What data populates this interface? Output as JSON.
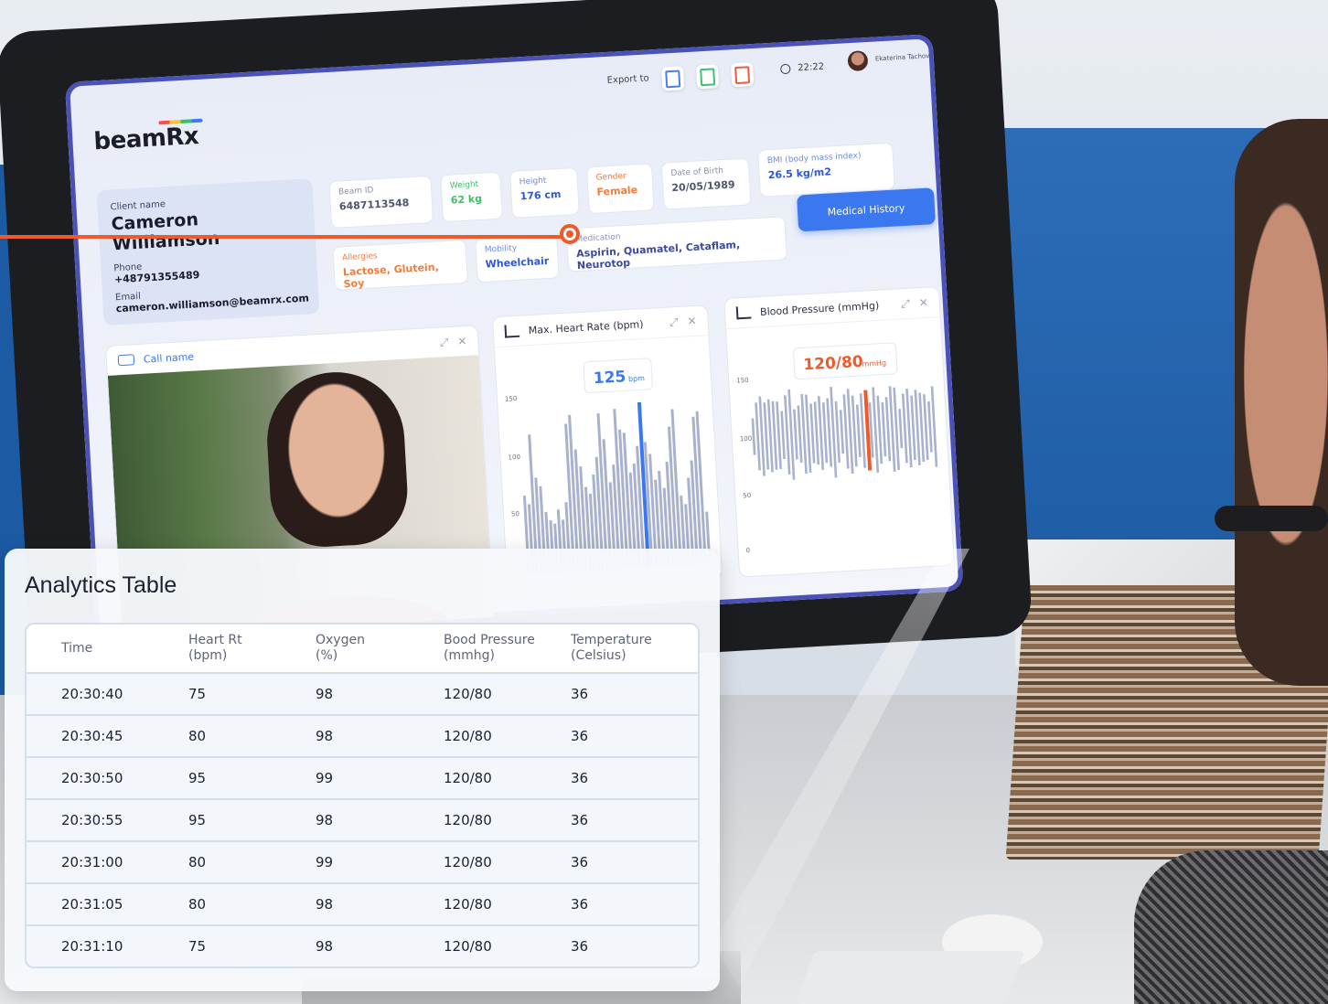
{
  "app": {
    "logo": "beamRx",
    "export_label": "Export to",
    "export_buttons": [
      "pdf-icon",
      "csv-icon",
      "xls-icon"
    ],
    "time": "22:22",
    "user_name": "Ekaterina Tachova"
  },
  "client": {
    "name_label": "Client name",
    "name": "Cameron Williamson",
    "phone_label": "Phone",
    "phone": "+48791355489",
    "email_label": "Email",
    "email": "cameron.williamson@beamrx.com"
  },
  "info": {
    "beam_id": {
      "label": "Beam ID",
      "value": "6487113548"
    },
    "weight": {
      "label": "Weight",
      "value": "62 kg"
    },
    "height": {
      "label": "Height",
      "value": "176 cm"
    },
    "gender": {
      "label": "Gender",
      "value": "Female"
    },
    "dob": {
      "label": "Date of Birth",
      "value": "20/05/1989"
    },
    "bmi": {
      "label": "BMI (body mass index)",
      "value": "26.5 kg/m2"
    },
    "allergies": {
      "label": "Allergies",
      "value": "Lactose, Glutein, Soy"
    },
    "mobility": {
      "label": "Mobility",
      "value": "Wheelchair"
    },
    "medication": {
      "label": "Medication",
      "value": "Aspirin, Quamatel, Cataflam, Neurotop"
    }
  },
  "medical_history_button": "Medical History",
  "call_panel": {
    "title": "Call name"
  },
  "heart_rate_panel": {
    "title": "Max. Heart Rate (bpm)",
    "callout_value": "125",
    "callout_unit": "bpm",
    "ticks": [
      "150",
      "100",
      "50"
    ],
    "bars": [
      45,
      40,
      80,
      55,
      50,
      35,
      30,
      28,
      36,
      30,
      40,
      85,
      90,
      70,
      60,
      48,
      44,
      55,
      65,
      90,
      75,
      50,
      60,
      92,
      80,
      78,
      55,
      60,
      70,
      95,
      72,
      65,
      50,
      55,
      45,
      60,
      80,
      90,
      40,
      35,
      50,
      60,
      85,
      88,
      30
    ],
    "highlight_index": 29
  },
  "bp_panel": {
    "title": "Blood Pressure (mmHg)",
    "callout_value": "120/80",
    "callout_unit": "mmHg",
    "ticks": [
      "150",
      "100",
      "50",
      "0"
    ]
  },
  "colors": {
    "accent": "#3b78f0",
    "orange": "#ee5a2a",
    "green": "#3cc16a"
  },
  "analytics": {
    "title": "Analytics Table",
    "columns": [
      {
        "l1": "Time",
        "l2": ""
      },
      {
        "l1": "Heart Rt",
        "l2": "(bpm)"
      },
      {
        "l1": "Oxygen",
        "l2": "(%)"
      },
      {
        "l1": "Bood Pressure",
        "l2": "(mmhg)"
      },
      {
        "l1": "Temperature",
        "l2": "(Celsius)"
      }
    ],
    "rows": [
      [
        "20:30:40",
        "75",
        "98",
        "120/80",
        "36"
      ],
      [
        "20:30:45",
        "80",
        "98",
        "120/80",
        "36"
      ],
      [
        "20:30:50",
        "95",
        "99",
        "120/80",
        "36"
      ],
      [
        "20:30:55",
        "95",
        "98",
        "120/80",
        "36"
      ],
      [
        "20:31:00",
        "80",
        "99",
        "120/80",
        "36"
      ],
      [
        "20:31:05",
        "80",
        "98",
        "120/80",
        "36"
      ],
      [
        "20:31:10",
        "75",
        "98",
        "120/80",
        "36"
      ]
    ]
  }
}
